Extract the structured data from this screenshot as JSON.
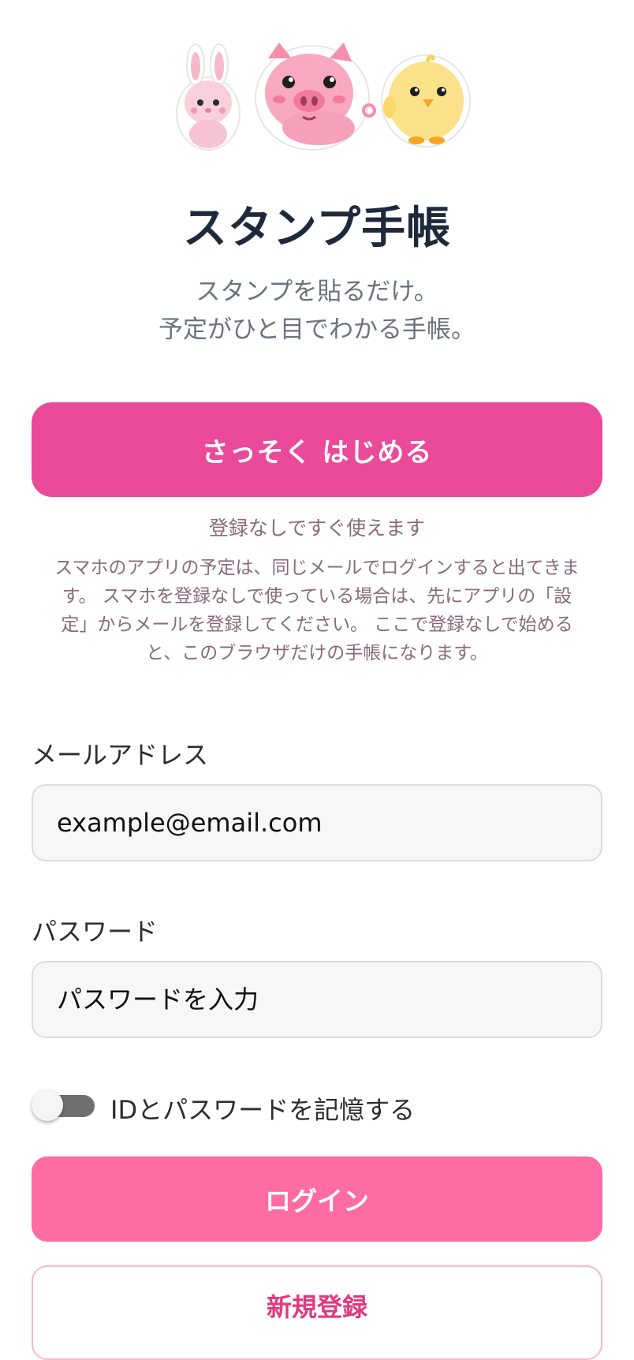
{
  "app": {
    "title": "スタンプ手帳",
    "tagline_line1": "スタンプを貼るだけ。",
    "tagline_line2": "予定がひと目でわかる手帳。"
  },
  "mascots": [
    "bunny-sticker",
    "pig-sticker",
    "chick-sticker"
  ],
  "guest": {
    "start_label": "さっそく はじめる",
    "note_short": "登録なしですぐ使えます",
    "note_long": "スマホのアプリの予定は、同じメールでログインすると出てきます。 スマホを登録なしで使っている場合は、先にアプリの「設定」からメールを登録してください。 ここで登録なしで始めると、このブラウザだけの手帳になります。"
  },
  "login_form": {
    "email_label": "メールアドレス",
    "email_placeholder": "example@email.com",
    "password_label": "パスワード",
    "password_placeholder": "パスワードを入力",
    "remember_label": "IDとパスワードを記憶する",
    "remember_checked": false,
    "login_label": "ログイン",
    "signup_label": "新規登録"
  },
  "colors": {
    "primary": "#ea4a99",
    "login": "#ff6ba3",
    "signup_text": "#e0397f",
    "title": "#1e2a3b"
  }
}
